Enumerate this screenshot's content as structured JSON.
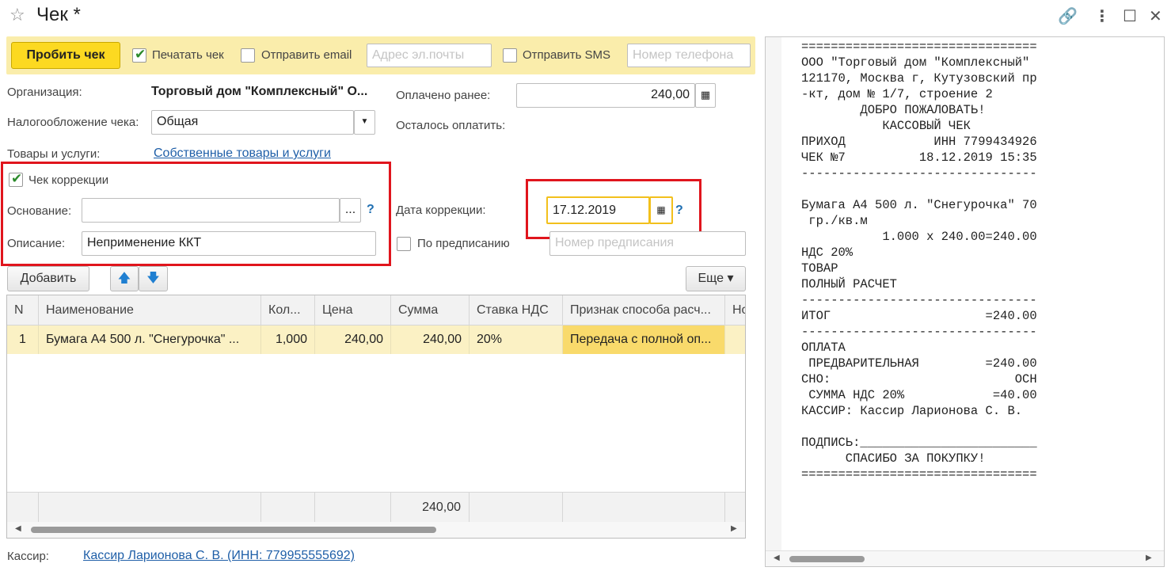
{
  "window": {
    "title": "Чек *"
  },
  "toolbar": {
    "punch_label": "Пробить чек",
    "print_label": "Печатать чек",
    "send_email_label": "Отправить email",
    "email_placeholder": "Адрес эл.почты",
    "send_sms_label": "Отправить SMS",
    "phone_placeholder": "Номер телефона"
  },
  "form": {
    "org_label": "Организация:",
    "org_value": "Торговый дом \"Комплексный\" О...",
    "paid_label": "Оплачено ранее:",
    "paid_value": "240,00",
    "tax_label": "Налогообложение чека:",
    "tax_value": "Общая",
    "remain_label": "Осталось оплатить:",
    "goods_label": "Товары и услуги:",
    "goods_link": "Собственные товары и услуги",
    "correction_label": "Чек коррекции",
    "basis_label": "Основание:",
    "basis_value": "",
    "desc_label": "Описание:",
    "desc_value": "Неприменение ККТ",
    "corr_date_label": "Дата коррекции:",
    "corr_date_value": "17.12.2019",
    "prescription_label": "По предписанию",
    "prescription_placeholder": "Номер предписания",
    "add_label": "Добавить",
    "more_label": "Еще",
    "cashier_label": "Кассир:",
    "cashier_link": "Кассир Ларионова С. В. (ИНН: 779955555692)"
  },
  "table": {
    "headers": [
      "N",
      "Наименование",
      "Кол...",
      "Цена",
      "Сумма",
      "Ставка НДС",
      "Признак способа расч...",
      "Но"
    ],
    "rows": [
      [
        "1",
        "Бумага А4 500 л. \"Снегурочка\" ...",
        "1,000",
        "240,00",
        "240,00",
        "20%",
        "Передача с полной оп..."
      ]
    ],
    "footer_total": "240,00"
  },
  "receipt": [
    "================================",
    "ООО \"Торговый дом \"Комплексный\"",
    "121170, Москва г, Кутузовский пр",
    "-кт, дом № 1/7, строение 2",
    "        ДОБРО ПОЖАЛОВАТЬ!",
    "           КАССОВЫЙ ЧЕК",
    "ПРИХОД            ИНН 7799434926",
    "ЧЕК №7          18.12.2019 15:35",
    "--------------------------------",
    "",
    "Бумага А4 500 л. \"Снегурочка\" 70",
    " гр./кв.м",
    "           1.000 x 240.00=240.00",
    "НДС 20%",
    "ТОВАР",
    "ПОЛНЫЙ РАСЧЕТ",
    "--------------------------------",
    "ИТОГ                     =240.00",
    "--------------------------------",
    "ОПЛАТА",
    " ПРЕДВАРИТЕЛЬНАЯ         =240.00",
    "СНО:                         ОСН",
    " СУММА НДС 20%            =40.00",
    "КАССИР: Кассир Ларионова С. В.",
    "",
    "ПОДПИСЬ:________________________",
    "      СПАСИБО ЗА ПОКУПКУ!",
    "================================"
  ]
}
